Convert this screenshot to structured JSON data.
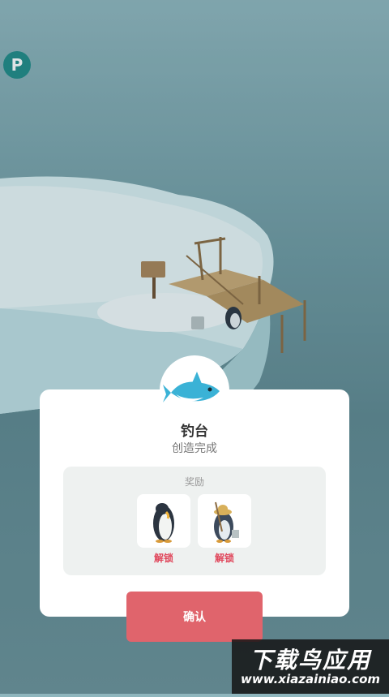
{
  "hud": {
    "p_badge": "P"
  },
  "dialog": {
    "title": "钓台",
    "subtitle": "创造完成",
    "reward_label": "奖励",
    "rewards": [
      {
        "icon": "emperor-penguin-icon",
        "status": "解锁"
      },
      {
        "icon": "fisher-penguin-icon",
        "status": "解锁"
      }
    ],
    "confirm_label": "确认",
    "header_icon": "shark-icon"
  },
  "watermark": {
    "title": "下载鸟应用",
    "url": "www.xiazainiao.com"
  },
  "colors": {
    "accent_button": "#e0646c",
    "unlock_text": "#e0485c",
    "p_badge": "#1f8a86"
  }
}
